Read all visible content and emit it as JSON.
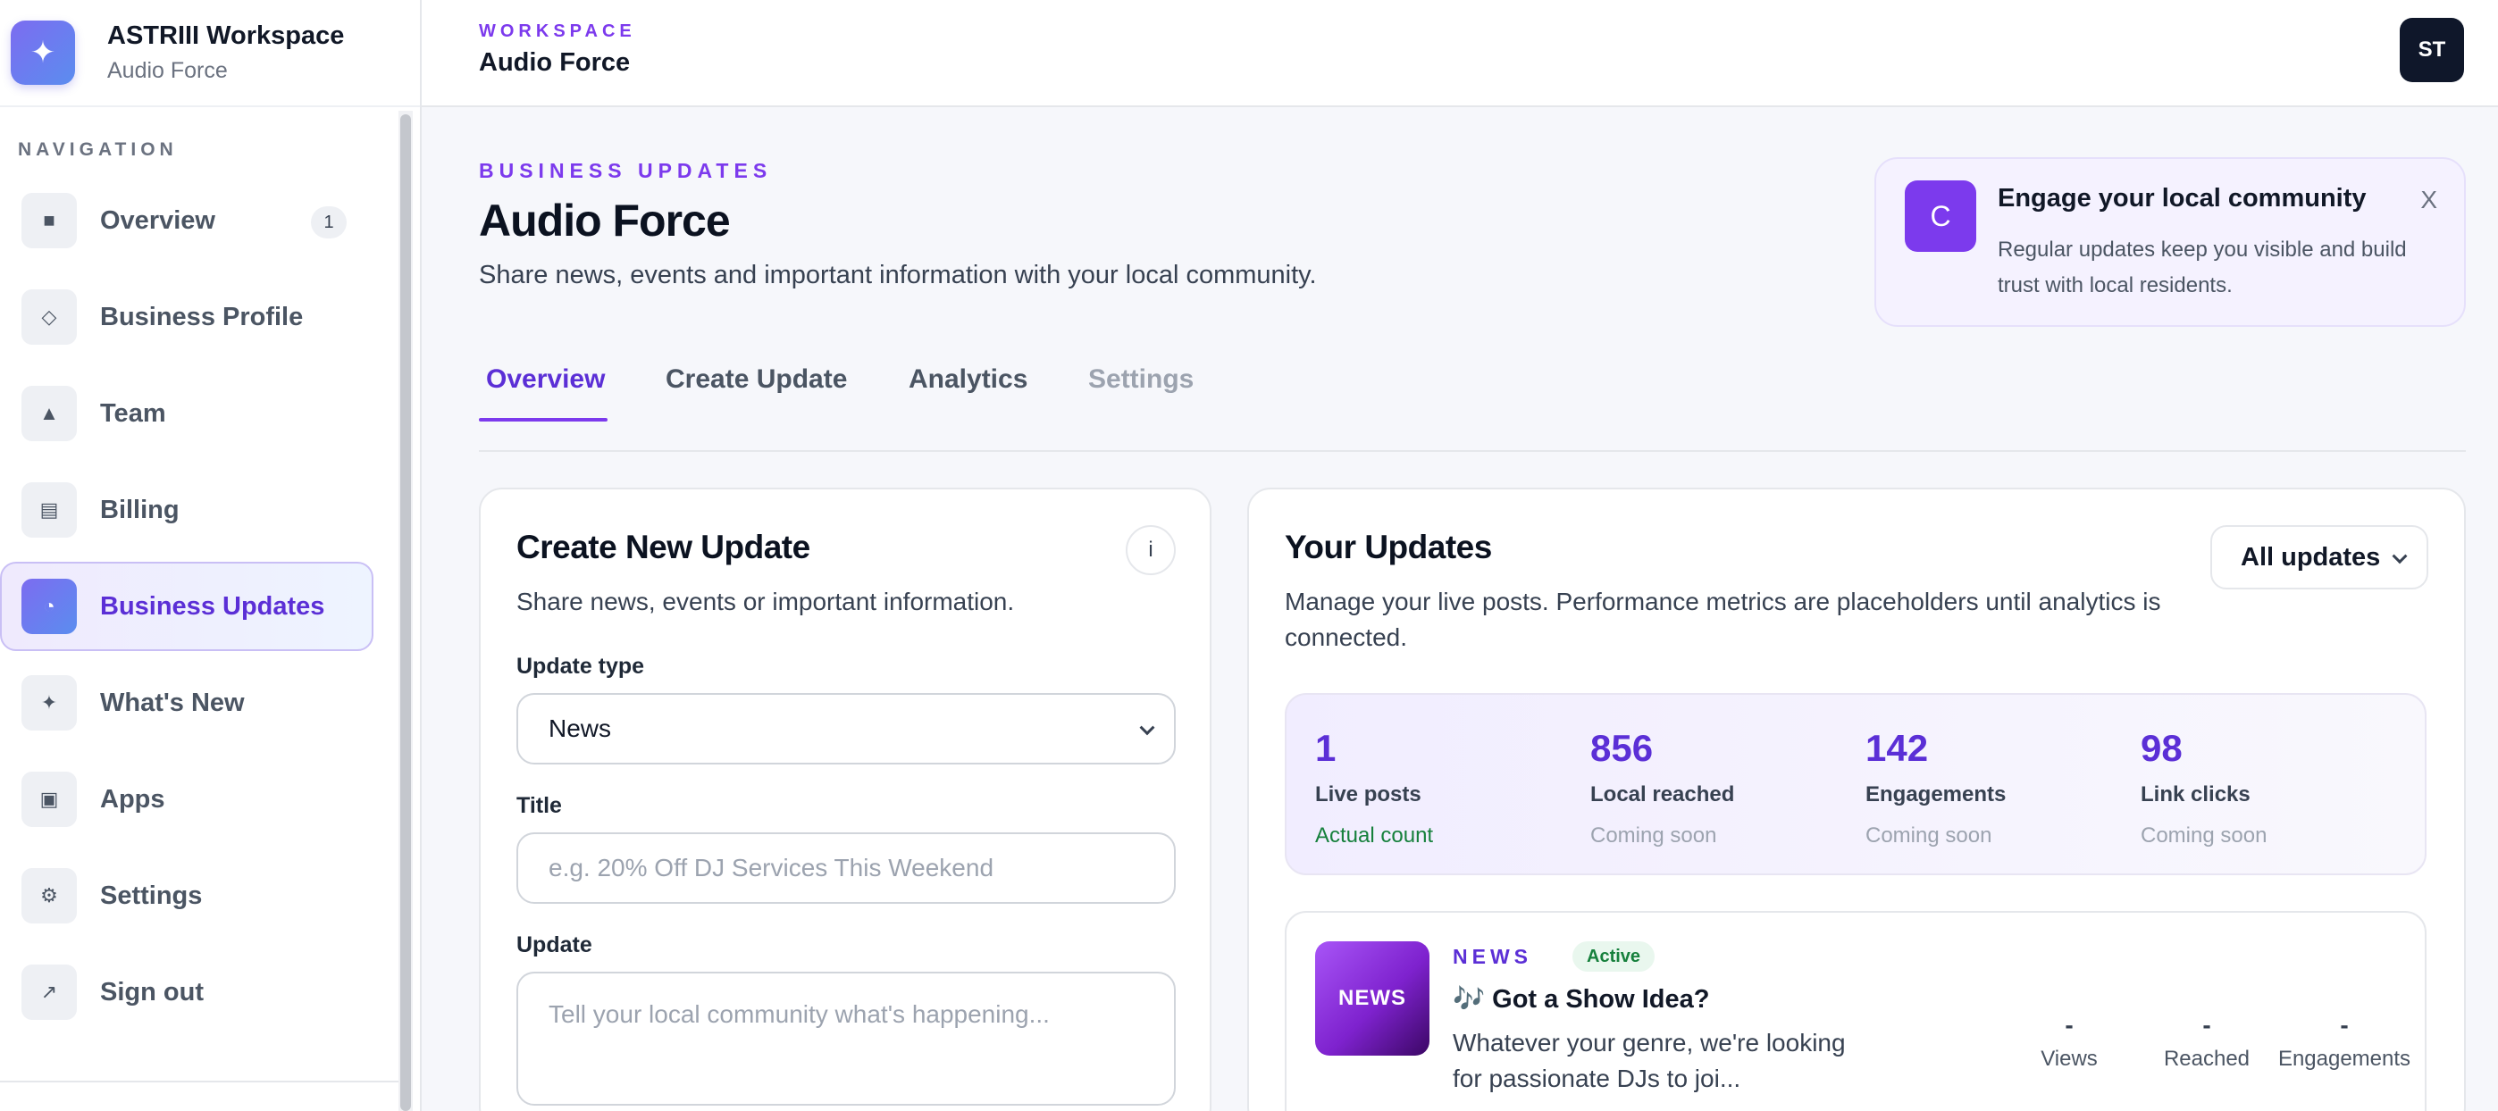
{
  "workspace": {
    "title": "ASTRIII Workspace",
    "subtitle": "Audio Force",
    "logo_icon": "sparkle-icon"
  },
  "sidebar": {
    "section_label": "NAVIGATION",
    "items": [
      {
        "label": "Overview",
        "icon": "square-icon",
        "badge": "1"
      },
      {
        "label": "Business Profile",
        "icon": "diamond-icon"
      },
      {
        "label": "Team",
        "icon": "person-icon"
      },
      {
        "label": "Billing",
        "icon": "card-icon"
      },
      {
        "label": "Business Updates",
        "icon": "pie-icon",
        "active": true
      },
      {
        "label": "What's New",
        "icon": "sparkle-icon"
      },
      {
        "label": "Apps",
        "icon": "app-grid-icon"
      },
      {
        "label": "Settings",
        "icon": "gear-icon"
      },
      {
        "label": "Sign out",
        "icon": "arrow-out-icon"
      }
    ]
  },
  "topbar": {
    "eyebrow": "WORKSPACE",
    "title": "Audio Force",
    "avatar": "ST"
  },
  "page": {
    "eyebrow": "BUSINESS UPDATES",
    "title": "Audio Force",
    "subtitle": "Share news, events and important information with your local community."
  },
  "tip": {
    "icon_letter": "C",
    "title": "Engage your local community",
    "body": "Regular updates keep you visible and build trust with local residents.",
    "close": "X"
  },
  "tabs": [
    {
      "label": "Overview",
      "active": true
    },
    {
      "label": "Create Update"
    },
    {
      "label": "Analytics"
    },
    {
      "label": "Settings",
      "muted": true
    }
  ],
  "create": {
    "title": "Create New Update",
    "subtitle": "Share news, events or important information.",
    "info": "i",
    "type_label": "Update type",
    "type_value": "News",
    "title_label": "Title",
    "title_placeholder": "e.g. 20% Off DJ Services This Weekend",
    "update_label": "Update",
    "update_placeholder": "Tell your local community what's happening..."
  },
  "updates": {
    "title": "Your Updates",
    "subtitle": "Manage your live posts. Performance metrics are placeholders until analytics is connected.",
    "filter": "All updates",
    "stats": [
      {
        "value": "1",
        "label": "Live posts",
        "note": "Actual count"
      },
      {
        "value": "856",
        "label": "Local reached",
        "note": "Coming soon"
      },
      {
        "value": "142",
        "label": "Engagements",
        "note": "Coming soon"
      },
      {
        "value": "98",
        "label": "Link clicks",
        "note": "Coming soon"
      }
    ],
    "post": {
      "thumb": "NEWS",
      "type": "NEWS",
      "status": "Active",
      "title": "🎶 Got a Show Idea?",
      "body": "Whatever your genre, we're looking for passionate DJs to joi...",
      "metrics": [
        {
          "value": "-",
          "label": "Views"
        },
        {
          "value": "-",
          "label": "Reached"
        },
        {
          "value": "-",
          "label": "Engagements"
        }
      ]
    }
  },
  "colors": {
    "accent": "#7c3aed",
    "active_text": "#5b2fd6",
    "success": "#16803c"
  }
}
